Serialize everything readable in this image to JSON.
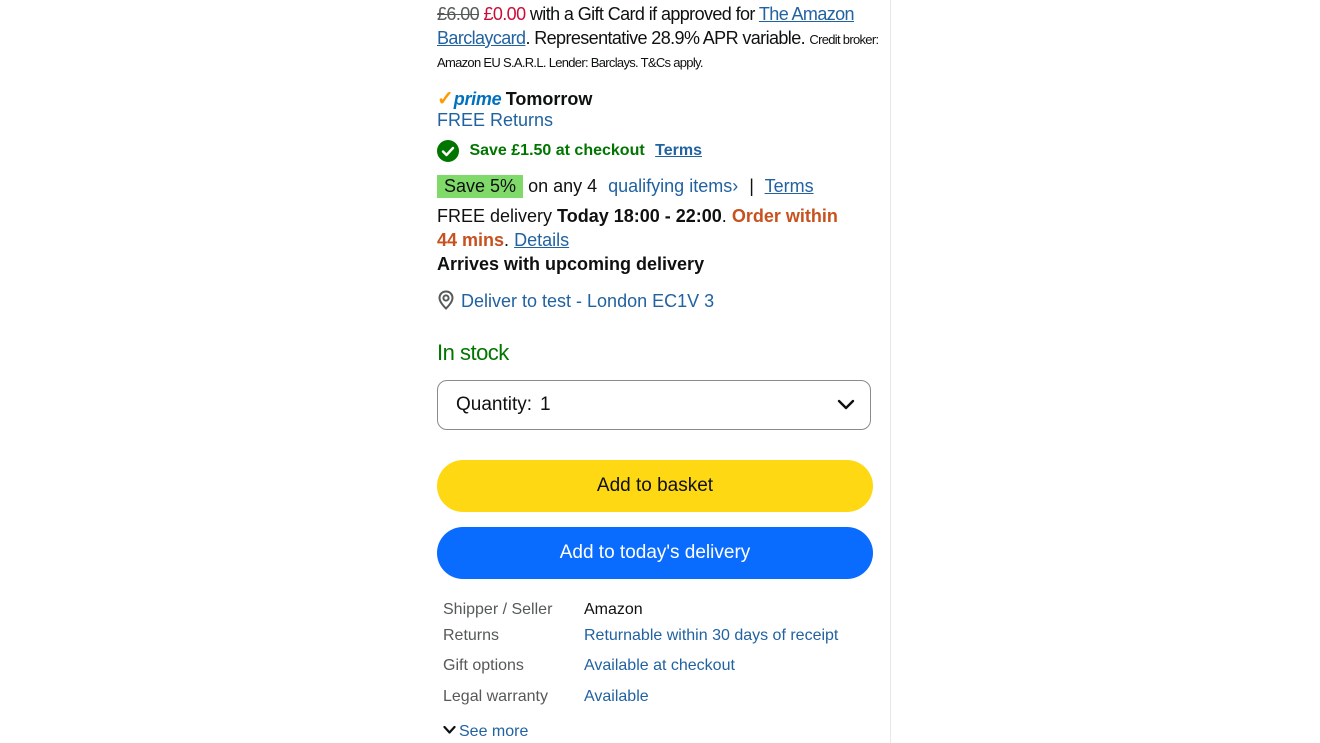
{
  "offer": {
    "old_price": "£6.00",
    "new_price": "£0.00",
    "text_1": "with a Gift Card if approved for",
    "card_link_1": "The Amazon",
    "card_link_2": "Barclaycard",
    "text_2": ". Representative 28.9% APR variable.",
    "small_1": "Credit broker:",
    "small_2": "Amazon EU S.A.R.L. Lender: Barclays. T&Cs apply."
  },
  "prime": {
    "check": "✓",
    "word": "prime",
    "delivery": "Tomorrow",
    "returns": "FREE Returns"
  },
  "coupon": {
    "text": "Save £1.50 at checkout",
    "terms": "Terms"
  },
  "promo": {
    "badge": "Save 5%",
    "text": "on any 4",
    "link": "qualifying items",
    "chevron": "›",
    "separator": "|",
    "terms": "Terms"
  },
  "delivery": {
    "prefix": "FREE delivery",
    "window": "Today 18:00 - 22:00",
    "dot": ".",
    "order_within_1": "Order within",
    "order_within_2": "44 mins",
    "dot2": ".",
    "details": "Details",
    "arrives": "Arrives with upcoming delivery",
    "location": "Deliver to test - London EC1V 3"
  },
  "stock": "In stock",
  "quantity": {
    "label": "Quantity:",
    "value": "1"
  },
  "buttons": {
    "add_to_basket": "Add to basket",
    "add_to_delivery": "Add to today's delivery"
  },
  "info": {
    "rows": [
      {
        "label": "Shipper / Seller",
        "value": "Amazon"
      },
      {
        "label": "Returns",
        "value": "Returnable within 30 days of receipt"
      },
      {
        "label": "Gift options",
        "value": "Available at checkout"
      },
      {
        "label": "Legal warranty",
        "value": "Available"
      }
    ],
    "see_more": "See more"
  },
  "icons": {
    "check_circle": "check-circle-icon",
    "location_pin": "location-pin-icon",
    "chevron_down": "chevron-down-icon"
  },
  "colors": {
    "link": "#2162a1",
    "price_red": "#cc0c39",
    "prime_blue": "#0070c0",
    "prime_orange": "#ff9900",
    "green": "#007600",
    "badge_green": "#7fda69",
    "order_orange": "#c7511f",
    "basket_yellow": "#ffd814",
    "delivery_blue": "#0a6cff"
  }
}
